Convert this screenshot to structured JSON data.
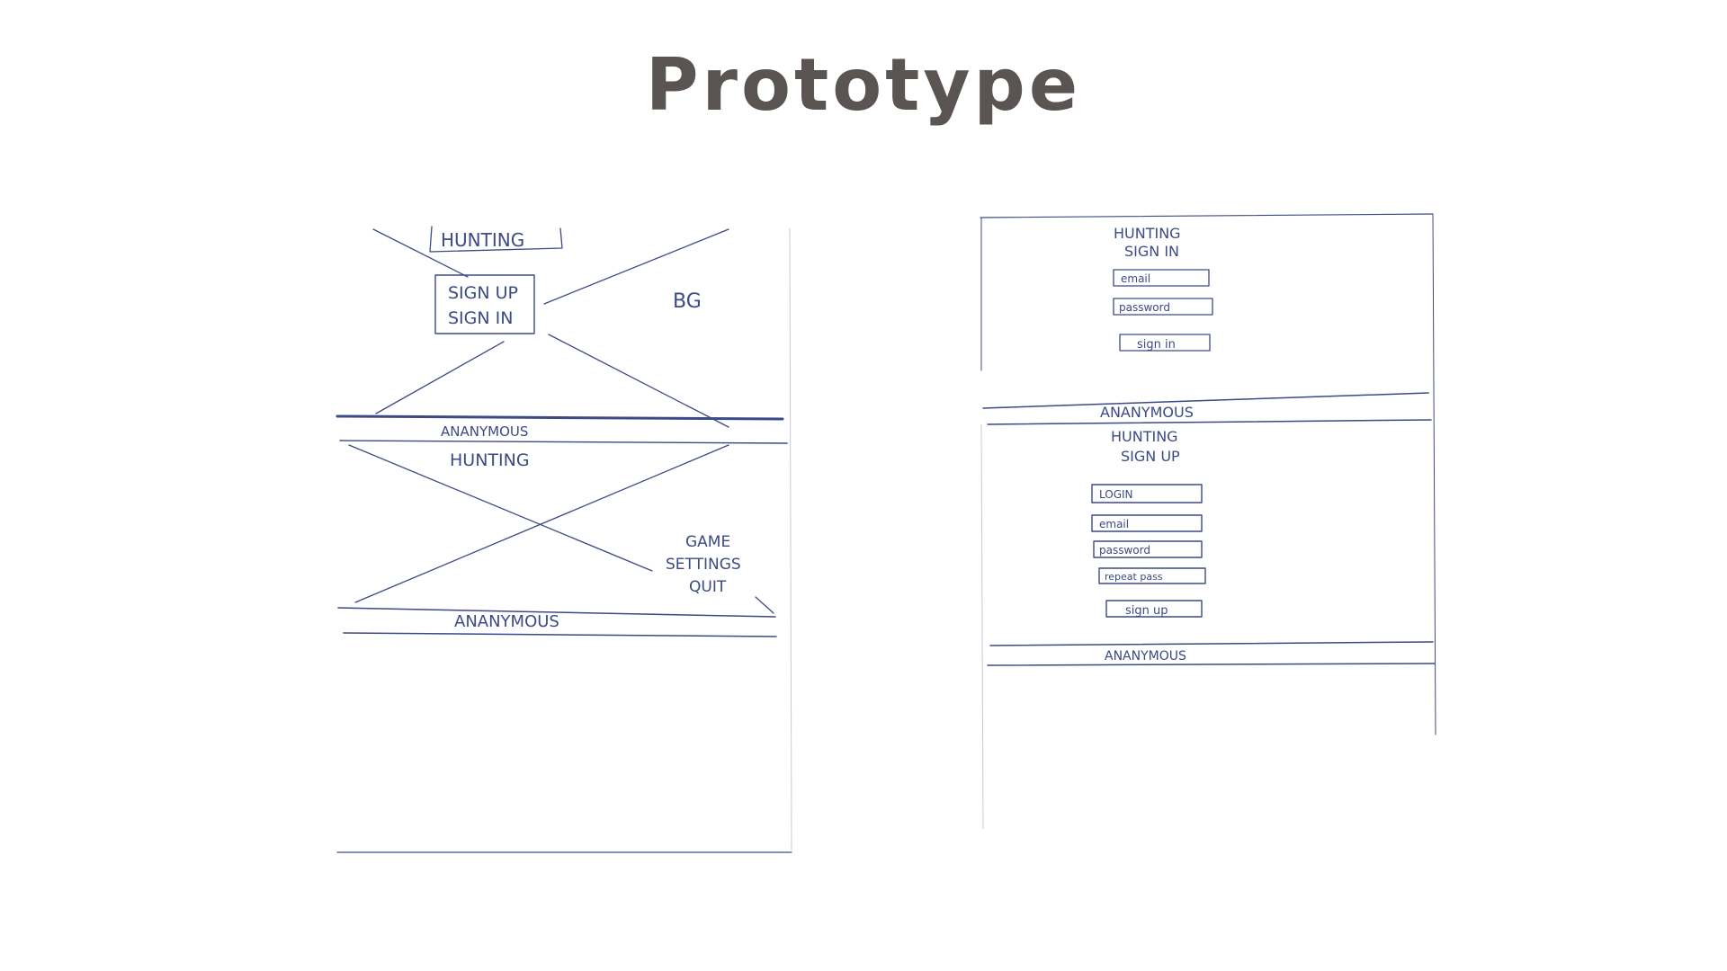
{
  "title": "Prototype",
  "left_sketch": {
    "screen1": {
      "logo": "HUNTING",
      "menu": [
        "SIGN UP",
        "SIGN IN"
      ],
      "bg_label": "BG",
      "footer": "ANANYMOUS"
    },
    "screen2": {
      "logo": "HUNTING",
      "menu": [
        "GAME",
        "SETTINGS",
        "QUIT"
      ],
      "footer": "ANANYMOUS"
    }
  },
  "right_sketch": {
    "signin": {
      "heading": [
        "HUNTING",
        "SIGN IN"
      ],
      "fields": [
        "email",
        "password"
      ],
      "button": "sign in",
      "footer": "ANANYMOUS"
    },
    "signup": {
      "heading": [
        "HUNTING",
        "SIGN UP"
      ],
      "fields": [
        "LOGIN",
        "email",
        "password",
        "repeat pass"
      ],
      "button": "sign up",
      "footer": "ANANYMOUS"
    }
  },
  "colors": {
    "ink": "#3c4a86",
    "title": "#5a5453"
  }
}
